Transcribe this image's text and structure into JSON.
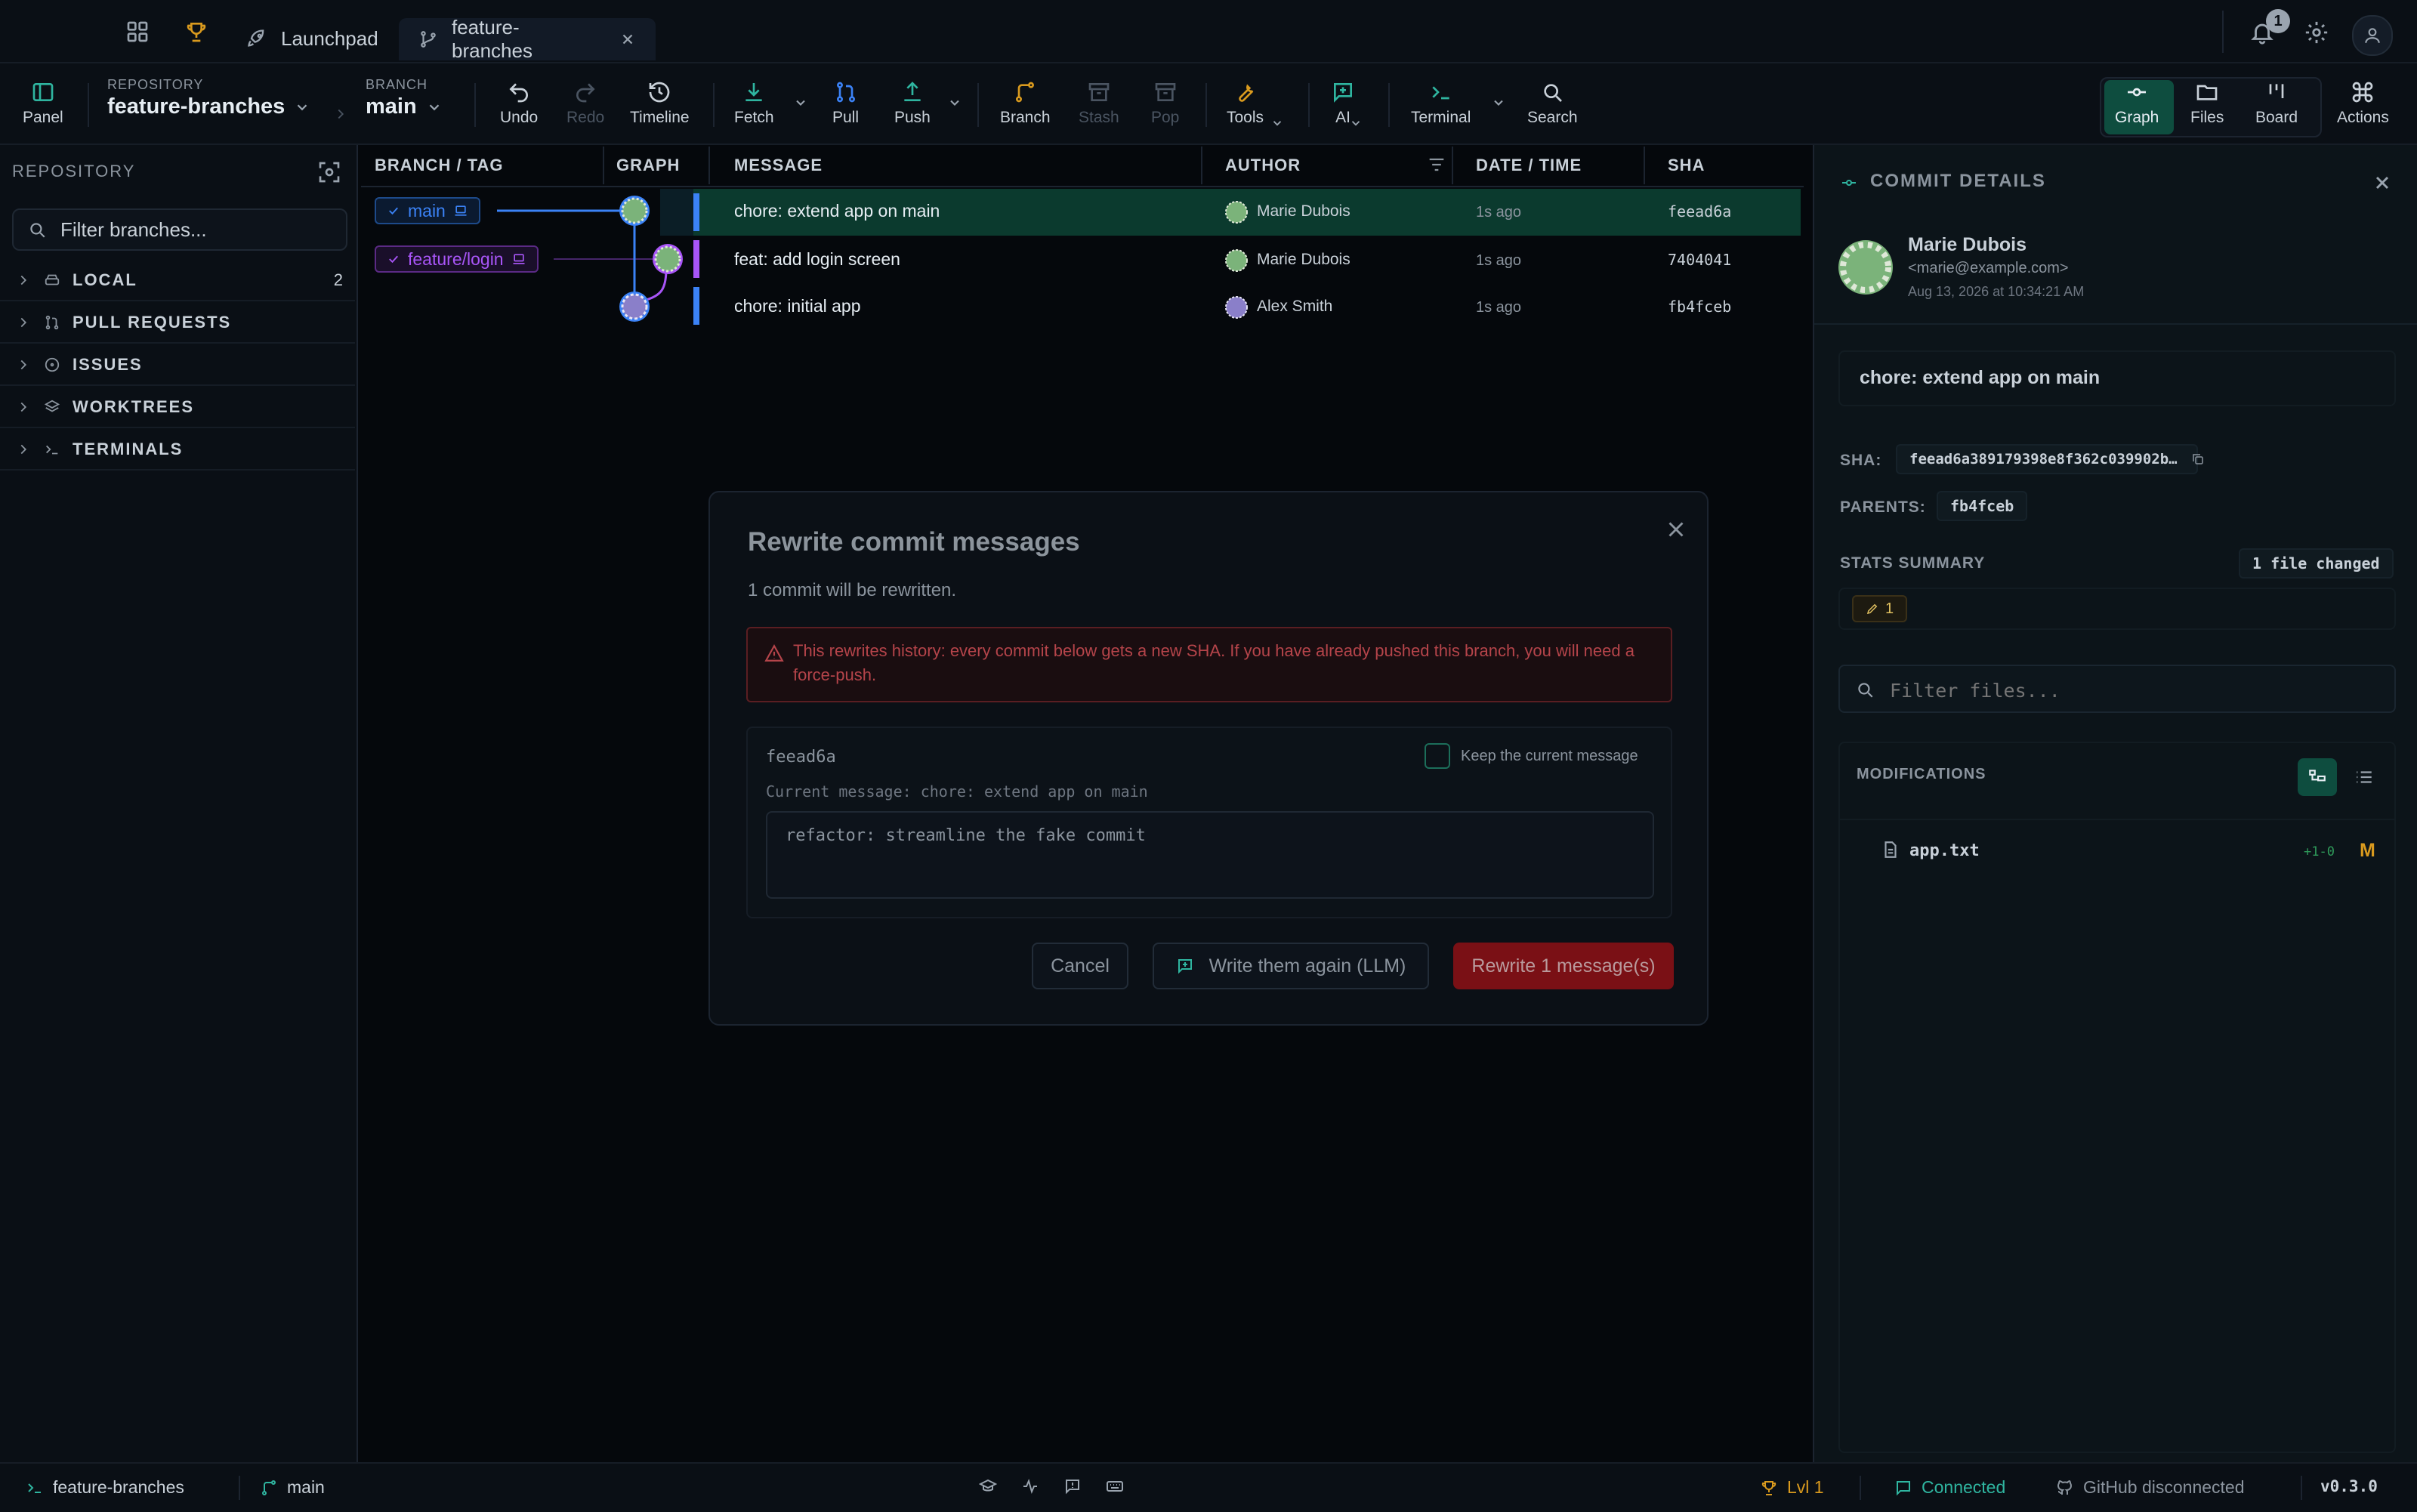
{
  "titlebar": {
    "tabs": [
      {
        "label": "Launchpad"
      },
      {
        "label": "feature-branches"
      }
    ],
    "notification_count": "1"
  },
  "toolbar": {
    "panel_label": "Panel",
    "repository_label": "REPOSITORY",
    "repository_value": "feature-branches",
    "branch_label": "BRANCH",
    "branch_value": "main",
    "undo": "Undo",
    "redo": "Redo",
    "timeline": "Timeline",
    "fetch": "Fetch",
    "pull": "Pull",
    "push": "Push",
    "branch": "Branch",
    "stash": "Stash",
    "pop": "Pop",
    "tools": "Tools",
    "ai": "AI",
    "terminal": "Terminal",
    "search": "Search",
    "graph": "Graph",
    "files": "Files",
    "board": "Board",
    "actions": "Actions"
  },
  "sidebar": {
    "title": "REPOSITORY",
    "filter_placeholder": "Filter branches...",
    "sections": [
      {
        "label": "LOCAL",
        "count": "2",
        "icon": "drive-icon"
      },
      {
        "label": "PULL REQUESTS",
        "icon": "pull-request-icon"
      },
      {
        "label": "ISSUES",
        "icon": "issue-icon"
      },
      {
        "label": "WORKTREES",
        "icon": "layers-icon"
      },
      {
        "label": "TERMINALS",
        "icon": "terminal-icon"
      }
    ]
  },
  "table": {
    "columns": [
      "BRANCH / TAG",
      "GRAPH",
      "MESSAGE",
      "AUTHOR",
      "DATE / TIME",
      "SHA"
    ],
    "refs": [
      {
        "label": "main",
        "color": "#3b82f6"
      },
      {
        "label": "feature/login",
        "color": "#a855f7"
      }
    ],
    "rows": [
      {
        "message": "chore: extend app on main",
        "author": "Marie Dubois",
        "date": "1s ago",
        "sha": "feead6a"
      },
      {
        "message": "feat: add login screen",
        "author": "Marie Dubois",
        "date": "1s ago",
        "sha": "7404041"
      },
      {
        "message": "chore: initial app",
        "author": "Alex Smith",
        "date": "1s ago",
        "sha": "fb4fceb"
      }
    ]
  },
  "modal": {
    "title": "Rewrite commit messages",
    "subtitle": "1 commit will be rewritten.",
    "warning": "This rewrites history: every commit below gets a new SHA. If you have already pushed this branch, you will need a force-push.",
    "commit_sha": "feead6a",
    "keep_label": "Keep the current message",
    "current_message": "Current message: chore: extend app on main",
    "new_message": "refactor: streamline the fake commit",
    "cancel": "Cancel",
    "llm": "Write them again (LLM)",
    "rewrite": "Rewrite 1 message(s)"
  },
  "details": {
    "title": "COMMIT DETAILS",
    "author_name": "Marie Dubois",
    "author_email": "<marie@example.com>",
    "date": "Aug 13, 2026 at 10:34:21 AM",
    "message": "chore: extend app on main",
    "sha_label": "SHA:",
    "sha_value": "feead6a389179398e8f362c039902b…",
    "parents_label": "PARENTS:",
    "parent": "fb4fceb",
    "stats_label": "STATS SUMMARY",
    "files_changed": "1 file changed",
    "edit_count": "1",
    "filter_placeholder": "Filter files...",
    "modifications_label": "MODIFICATIONS",
    "file_name": "app.txt",
    "file_diff": "+1-0",
    "file_status": "M"
  },
  "statusbar": {
    "repo": "feature-branches",
    "branch": "main",
    "level": "Lvl 1",
    "connected": "Connected",
    "github": "GitHub disconnected",
    "version": "v0.3.0"
  },
  "colors": {
    "accent_green": "#1f9d7a",
    "danger": "#7a1015",
    "main_branch": "#3b82f6",
    "feature_branch": "#a855f7",
    "level_gold": "#d99a1e"
  }
}
